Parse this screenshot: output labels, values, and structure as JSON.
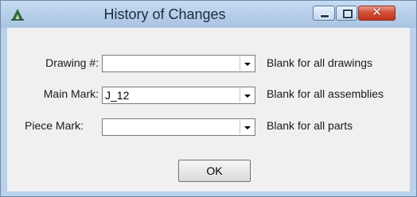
{
  "window": {
    "title": "History of Changes"
  },
  "form": {
    "rows": [
      {
        "label": "Drawing #:",
        "value": "",
        "hint": "Blank for all drawings"
      },
      {
        "label": "Main Mark:",
        "value": "J_12",
        "hint": "Blank for all assemblies"
      },
      {
        "label": "Piece Mark:",
        "value": "",
        "hint": "Blank for all parts"
      }
    ],
    "ok_label": "OK"
  },
  "colors": {
    "frame": "#b9d1ea",
    "client": "#f0f0f0",
    "close_button": "#c2341c"
  },
  "icons": {
    "app": "app-logo-icon",
    "minimize": "minimize-icon",
    "maximize": "maximize-icon",
    "close": "close-icon",
    "dropdown": "chevron-down-icon"
  }
}
